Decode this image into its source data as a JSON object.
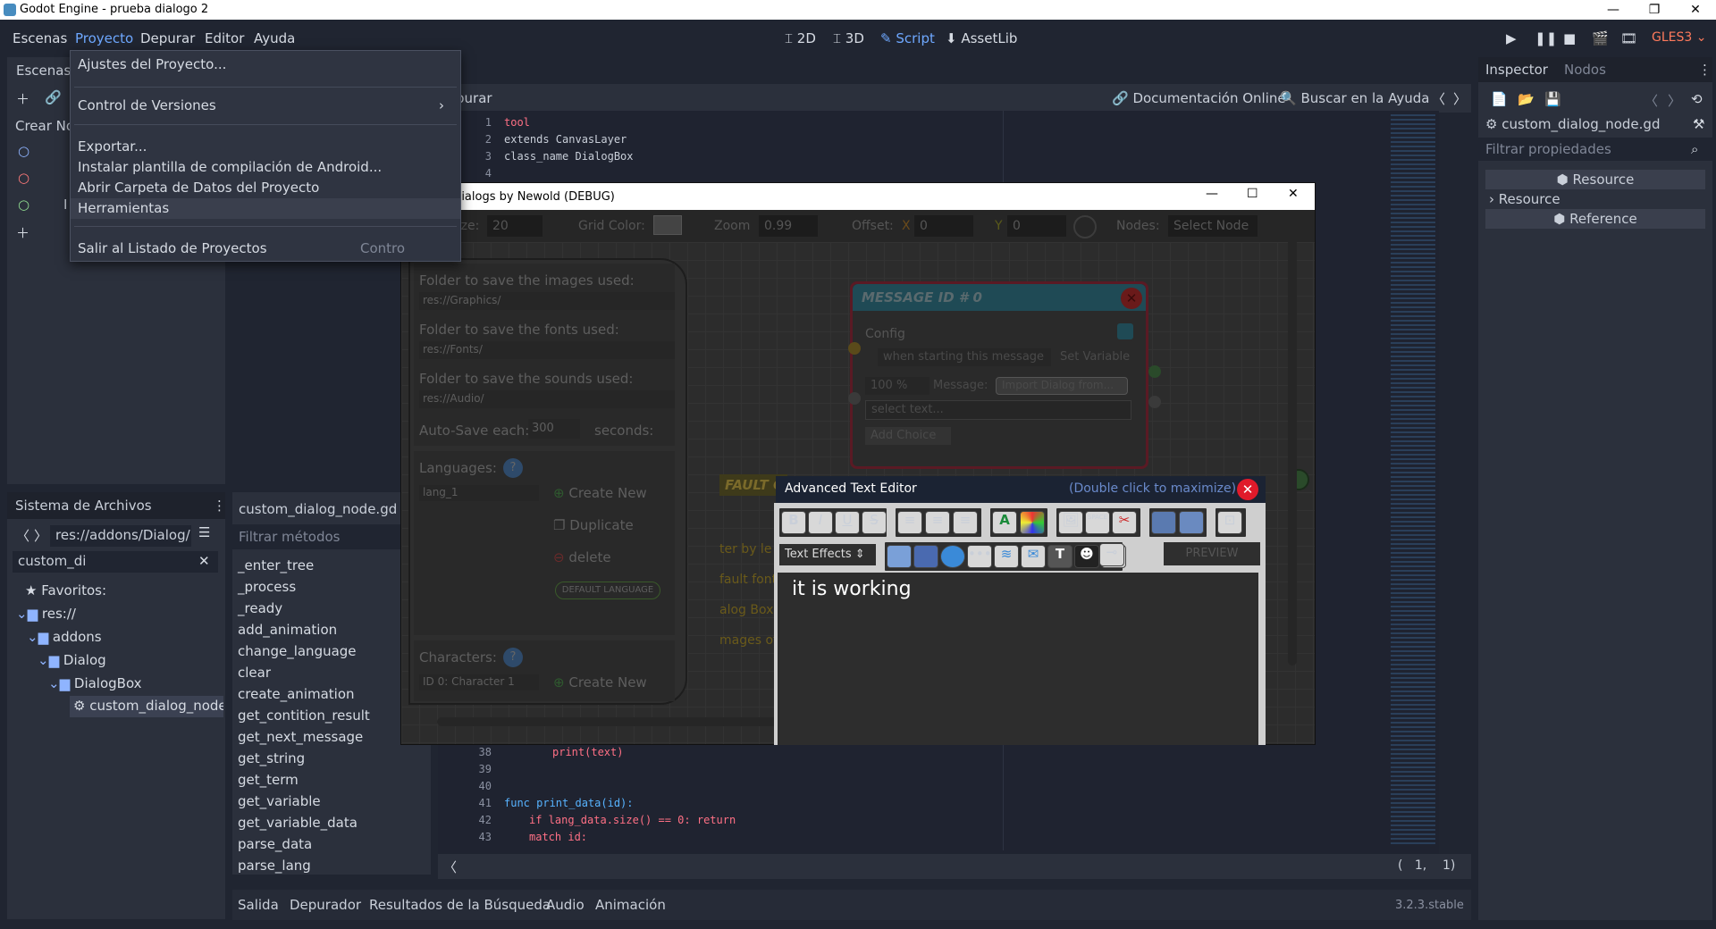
{
  "window": {
    "title": "Godot Engine - prueba dialogo 2"
  },
  "menu": {
    "items": [
      "Escenas",
      "Proyecto",
      "Depurar",
      "Editor",
      "Ayuda"
    ]
  },
  "modes": {
    "m2d": "2D",
    "m3d": "3D",
    "script": "Script",
    "assetlib": "AssetLib"
  },
  "renderer": "GLES3",
  "dropdown": {
    "settings": "Ajustes del Proyecto...",
    "vcs": "Control de Versiones",
    "export": "Exportar...",
    "android": "Instalar plantilla de compilación de Android...",
    "datafolder": "Abrir Carpeta de Datos del Proyecto",
    "tools": "Herramientas",
    "quit": "Salir al Listado de Proyectos",
    "quit_shortcut": "Contro"
  },
  "scene_dock": {
    "tab": "Escenas",
    "create": "Crear No",
    "partial": "I"
  },
  "fs_dock": {
    "tab": "Sistema de Archivos",
    "path": "res://addons/Dialog/D",
    "filter": "custom_di",
    "favorites": "Favoritos:",
    "res": "res://",
    "addons": "addons",
    "dialog": "Dialog",
    "dialogbox": "DialogBox",
    "file": "custom_dialog_node."
  },
  "methods": {
    "title": "custom_dialog_node.gd",
    "filter_placeholder": "Filtrar métodos",
    "items": [
      "_enter_tree",
      "_process",
      "_ready",
      "add_animation",
      "change_language",
      "clear",
      "create_animation",
      "get_contition_result",
      "get_next_message",
      "get_string",
      "get_term",
      "get_variable",
      "get_variable_data",
      "parse_data",
      "parse_lang"
    ]
  },
  "script_toolbar": {
    "partial": "purar",
    "doc": "Documentación Online",
    "search": "Buscar en la Ayuda"
  },
  "code_top": [
    {
      "n": "1",
      "t": "tool"
    },
    {
      "n": "2",
      "t": "extends CanvasLayer"
    },
    {
      "n": "3",
      "t": "class_name DialogBox"
    },
    {
      "n": "4",
      "t": ""
    }
  ],
  "code_bottom": [
    {
      "n": "38",
      "t": "print(text)"
    },
    {
      "n": "39",
      "t": ""
    },
    {
      "n": "40",
      "t": ""
    },
    {
      "n": "41",
      "t": "func print_data(id):"
    },
    {
      "n": "42",
      "t": "if lang_data.size() == 0: return"
    },
    {
      "n": "43",
      "t": "match id:"
    }
  ],
  "cursor_pos": "(   1,    1)",
  "bottom_tabs": [
    "Salida",
    "Depurador",
    "Resultados de la Búsqueda",
    "Audio",
    "Animación"
  ],
  "version": "3.2.3.stable",
  "inspector": {
    "tab1": "Inspector",
    "tab2": "Nodos",
    "file": "custom_dialog_node.gd",
    "filter": "Filtrar propiedades",
    "resource_hdr": "Resource",
    "resource": "Resource",
    "reference": "Reference"
  },
  "dialog": {
    "title": "Edit Dialogs by Newold (DEBUG)",
    "grid_size_label": "Grid Size:",
    "grid_size": "20",
    "grid_color_label": "Grid Color:",
    "zoom_label": "Zoom",
    "zoom": "0.99",
    "offset_label": "Offset:",
    "x": "X",
    "xv": "0",
    "y": "Y",
    "yv": "0",
    "nodes_label": "Nodes:",
    "nodes_value": "Select Node",
    "folder_images": "Folder to save the images used:",
    "path_images": "res://Graphics/",
    "folder_fonts": "Folder to save the fonts used:",
    "path_fonts": "res://Fonts/",
    "folder_sounds": "Folder to save the sounds used:",
    "path_sounds": "res://Audio/",
    "autosave": "Auto-Save each:",
    "autosave_val": "300",
    "seconds": "seconds:",
    "languages": "Languages:",
    "lang1": "lang_1",
    "create_new": "Create New",
    "duplicate": "Duplicate",
    "delete": "delete",
    "default_lang": "DEFAULT LANGUAGE",
    "characters": "Characters:",
    "char1": "ID 0: Character 1",
    "create_new2": "Create New",
    "msg_title": "MESSAGE ID # 0",
    "config": "Config",
    "when": "when starting this message",
    "set_variable": "Set Variable",
    "pct": "100 %",
    "message": "Message:",
    "import": "Import Dialog from...",
    "select_text": "select text...",
    "add_choice": "Add Choice",
    "frag1": "FAULT C",
    "frag2": "ter by le",
    "frag3": "fault font",
    "frag4": "alog Box I",
    "frag5": "mages of th"
  },
  "ate": {
    "title": "Advanced Text Editor",
    "hint": "(Double click to maximize)",
    "text_effects": "Text Effects",
    "preview": "PREVIEW",
    "content": "it is working"
  }
}
